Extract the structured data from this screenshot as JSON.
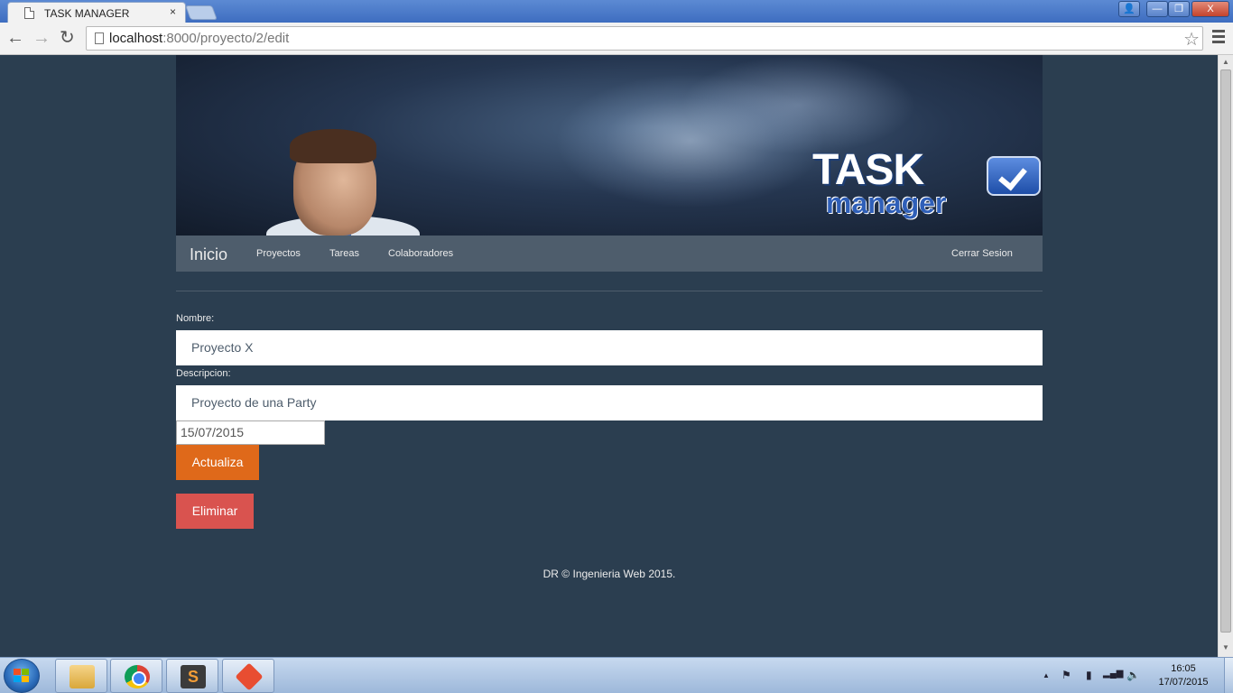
{
  "browser": {
    "tab_title": "TASK MANAGER",
    "tab_close": "×",
    "url_host": "localhost",
    "url_rest": ":8000/proyecto/2/edit",
    "window_controls": {
      "user": "👤",
      "minimize": "—",
      "restore": "❐",
      "close": "X"
    },
    "icons": {
      "back": "back-arrow-icon",
      "forward": "forward-arrow-icon",
      "reload": "reload-icon",
      "bookmark": "star-icon",
      "menu": "hamburger-menu-icon"
    }
  },
  "banner": {
    "logo_task": "TASK",
    "logo_manager": "manager"
  },
  "navbar": {
    "brand": "Inicio",
    "links": [
      "Proyectos",
      "Tareas",
      "Colaboradores"
    ],
    "logout": "Cerrar Sesion"
  },
  "form": {
    "nombre_label": "Nombre:",
    "nombre_value": "Proyecto X",
    "descripcion_label": "Descripcion:",
    "descripcion_value": "Proyecto de una Party",
    "fecha_value": "15/07/2015",
    "update_button": "Actualiza",
    "delete_button": "Eliminar"
  },
  "footer": {
    "text": "DR © Ingenieria Web 2015."
  },
  "colors": {
    "page_bg": "#2b3e50",
    "navbar_bg": "#4e5d6c",
    "update_button": "#df691a",
    "delete_button": "#d9534f"
  },
  "taskbar": {
    "apps": [
      "file-explorer-icon",
      "chrome-icon",
      "sublime-text-icon",
      "git-icon"
    ],
    "sublime_letter": "S",
    "tray": {
      "show_hidden": "▲",
      "flag": "⚑",
      "battery": "▮",
      "signal": "▂▄▆",
      "volume": "🔈"
    },
    "clock_time": "16:05",
    "clock_date": "17/07/2015"
  }
}
